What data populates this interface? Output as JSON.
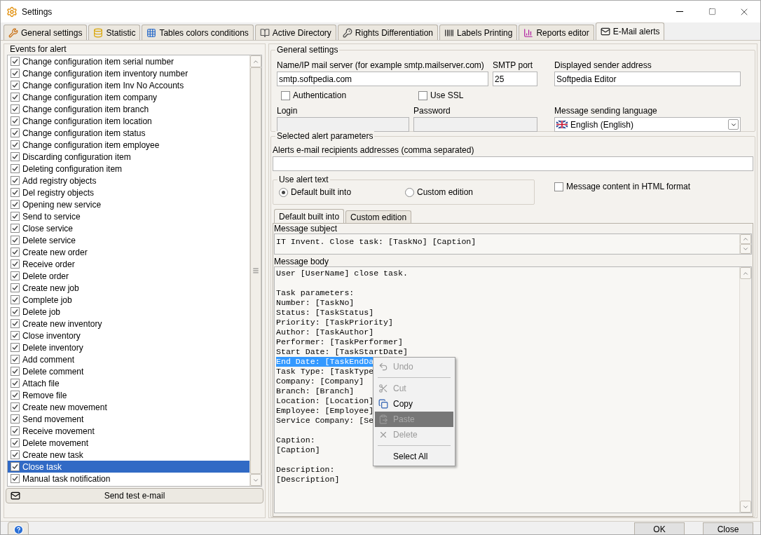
{
  "window": {
    "title": "Settings"
  },
  "tabs": [
    {
      "label": "General settings",
      "selected": false
    },
    {
      "label": "Statistic",
      "selected": false
    },
    {
      "label": "Tables colors conditions",
      "selected": false
    },
    {
      "label": "Active Directory",
      "selected": false
    },
    {
      "label": "Rights Differentiation",
      "selected": false
    },
    {
      "label": "Labels Printing",
      "selected": false
    },
    {
      "label": "Reports editor",
      "selected": false
    },
    {
      "label": "E-Mail alerts",
      "selected": true
    }
  ],
  "events": {
    "title": "Events for alert",
    "items": [
      {
        "label": "Change configuration item serial number",
        "checked": true,
        "selected": false
      },
      {
        "label": "Change configuration item inventory number",
        "checked": true,
        "selected": false
      },
      {
        "label": "Change configuration item Inv No Accounts",
        "checked": true,
        "selected": false
      },
      {
        "label": "Change configuration item company",
        "checked": true,
        "selected": false
      },
      {
        "label": "Change configuration item branch",
        "checked": true,
        "selected": false
      },
      {
        "label": "Change configuration item location",
        "checked": true,
        "selected": false
      },
      {
        "label": "Change configuration item status",
        "checked": true,
        "selected": false
      },
      {
        "label": "Change configuration item employee",
        "checked": true,
        "selected": false
      },
      {
        "label": "Discarding configuration item",
        "checked": true,
        "selected": false
      },
      {
        "label": "Deleting configuration item",
        "checked": true,
        "selected": false
      },
      {
        "label": "Add registry objects",
        "checked": true,
        "selected": false
      },
      {
        "label": "Del registry objects",
        "checked": true,
        "selected": false
      },
      {
        "label": "Opening new service",
        "checked": true,
        "selected": false
      },
      {
        "label": "Send to service",
        "checked": true,
        "selected": false
      },
      {
        "label": "Close service",
        "checked": true,
        "selected": false
      },
      {
        "label": "Delete service",
        "checked": true,
        "selected": false
      },
      {
        "label": "Create new order",
        "checked": true,
        "selected": false
      },
      {
        "label": "Receive order",
        "checked": true,
        "selected": false
      },
      {
        "label": "Delete order",
        "checked": true,
        "selected": false
      },
      {
        "label": "Create new job",
        "checked": true,
        "selected": false
      },
      {
        "label": "Complete job",
        "checked": true,
        "selected": false
      },
      {
        "label": "Delete job",
        "checked": true,
        "selected": false
      },
      {
        "label": "Create new inventory",
        "checked": true,
        "selected": false
      },
      {
        "label": "Close inventory",
        "checked": true,
        "selected": false
      },
      {
        "label": "Delete inventory",
        "checked": true,
        "selected": false
      },
      {
        "label": "Add comment",
        "checked": true,
        "selected": false
      },
      {
        "label": "Delete comment",
        "checked": true,
        "selected": false
      },
      {
        "label": "Attach file",
        "checked": true,
        "selected": false
      },
      {
        "label": "Remove file",
        "checked": true,
        "selected": false
      },
      {
        "label": "Create new movement",
        "checked": true,
        "selected": false
      },
      {
        "label": "Send movement",
        "checked": true,
        "selected": false
      },
      {
        "label": "Receive movement",
        "checked": true,
        "selected": false
      },
      {
        "label": "Delete movement",
        "checked": true,
        "selected": false
      },
      {
        "label": "Create new task",
        "checked": true,
        "selected": false
      },
      {
        "label": "Close task",
        "checked": true,
        "selected": true
      },
      {
        "label": "Manual task notification",
        "checked": true,
        "selected": false
      }
    ],
    "send_button": "Send test e-mail"
  },
  "general": {
    "title": "General settings",
    "server": {
      "label": "Name/IP mail server (for example smtp.mailserver.com)",
      "value": "smtp.softpedia.com"
    },
    "port": {
      "label": "SMTP port",
      "value": "25"
    },
    "sender": {
      "label": "Displayed sender address",
      "value": "Softpedia Editor"
    },
    "authentication": {
      "label": "Authentication",
      "checked": false
    },
    "ssl": {
      "label": "Use SSL",
      "checked": false
    },
    "login": {
      "label": "Login",
      "disabled": true
    },
    "password": {
      "label": "Password",
      "disabled": true
    },
    "language": {
      "label": "Message sending language",
      "value": "English (English)"
    }
  },
  "alert": {
    "title": "Selected alert parameters",
    "recipients_label": "Alerts e-mail recipients addresses (comma separated)",
    "alert_text": {
      "title": "Use alert text",
      "options": [
        {
          "label": "Default built into",
          "selected": true
        },
        {
          "label": "Custom edition",
          "selected": false
        }
      ]
    },
    "html": {
      "label": "Message content in HTML format",
      "checked": false
    },
    "subtabs": [
      {
        "label": "Default built into",
        "selected": true
      },
      {
        "label": "Custom edition",
        "selected": false
      }
    ],
    "subject": {
      "label": "Message subject",
      "value": "IT Invent. Close task: [TaskNo] [Caption]"
    },
    "body": {
      "label": "Message body",
      "blocks": [
        [
          "User [UserName] close task."
        ],
        [
          "Task parameters:",
          "Number: [TaskNo]",
          "Status: [TaskStatus]",
          "Priority: [TaskPriority]",
          "Author: [TaskAuthor]",
          "Performer: [TaskPerformer]",
          "Start Date: [TaskStartDate]",
          {
            "text": "End Date: [TaskEndDa",
            "selected": true
          },
          "Task Type: [TaskType",
          "Company: [Company]",
          "Branch: [Branch]",
          "Location: [Location]",
          "Employee: [Employee]",
          "Service Company: [Se"
        ],
        [
          "Caption:",
          "[Caption]"
        ],
        [
          "Description:",
          "[Description]"
        ]
      ]
    },
    "menu": [
      {
        "kind": "item",
        "label": "Undo",
        "disabled": true,
        "selected": false
      },
      {
        "kind": "separator"
      },
      {
        "kind": "item",
        "label": "Cut",
        "disabled": true,
        "selected": false
      },
      {
        "kind": "item",
        "label": "Copy",
        "disabled": false,
        "selected": false
      },
      {
        "kind": "item",
        "label": "Paste",
        "disabled": true,
        "selected": true
      },
      {
        "kind": "item",
        "label": "Delete",
        "disabled": true,
        "selected": false
      },
      {
        "kind": "separator"
      },
      {
        "kind": "item",
        "label": "Select All",
        "disabled": false,
        "selected": false
      }
    ]
  },
  "buttons": [
    "OK",
    "Close"
  ]
}
